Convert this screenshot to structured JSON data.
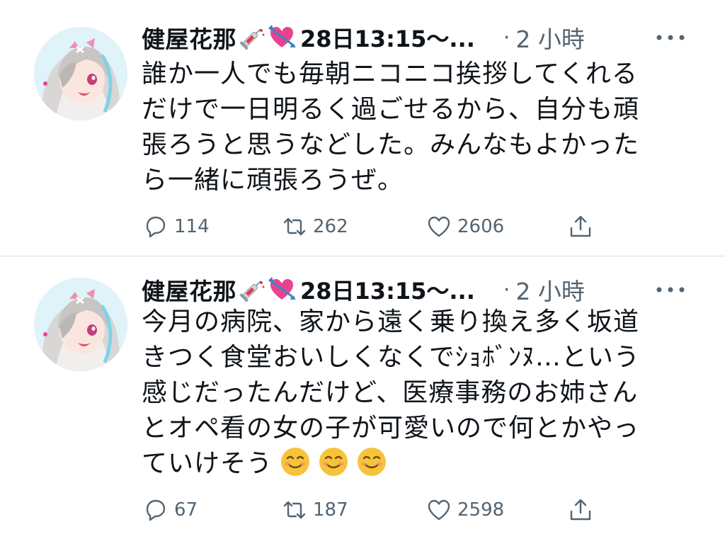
{
  "tweets": [
    {
      "author_name": "健屋花那",
      "handle": "28日13:15～...",
      "dot": "·",
      "time": "2 小時",
      "text": "誰か一人でも毎朝ニコニコ挨拶してくれる\nだけで一日明るく過ごせるから、自分も頑\n張ろうと思うなどした。みんなもよかった\nら一緒に頑張ろうぜ。",
      "emojis": [],
      "replies": "114",
      "retweets": "262",
      "likes": "2606"
    },
    {
      "author_name": "健屋花那",
      "handle": "28日13:15～...",
      "dot": "·",
      "time": "2 小時",
      "text": "今月の病院、家から遠く乗り換え多く坂道\nきつく食堂おいしくなくでｼｮﾎﾞﾝﾇ…という\n感じだったんだけど、医療事務のお姉さん\nとオペ看の女の子が可愛いので何とかやっ\nていけそう",
      "emojis": [
        "smiling-face-emoji",
        "smiling-face-emoji",
        "smiling-face-emoji"
      ],
      "replies": "67",
      "retweets": "187",
      "likes": "2598"
    }
  ],
  "icons": {
    "reply": "reply-icon",
    "retweet": "retweet-icon",
    "like": "heart-icon",
    "share": "share-icon",
    "more": "more-icon",
    "name_emoji_1": "syringe-emoji",
    "name_emoji_2": "heart-with-arrow-emoji"
  },
  "colors": {
    "text": "#0f1419",
    "secondary": "#536471",
    "divider": "#d8dde2",
    "avatar_bg": "#dff3f8",
    "heart_emoji": "#e8438f",
    "smile_emoji": "#f7c33a"
  }
}
